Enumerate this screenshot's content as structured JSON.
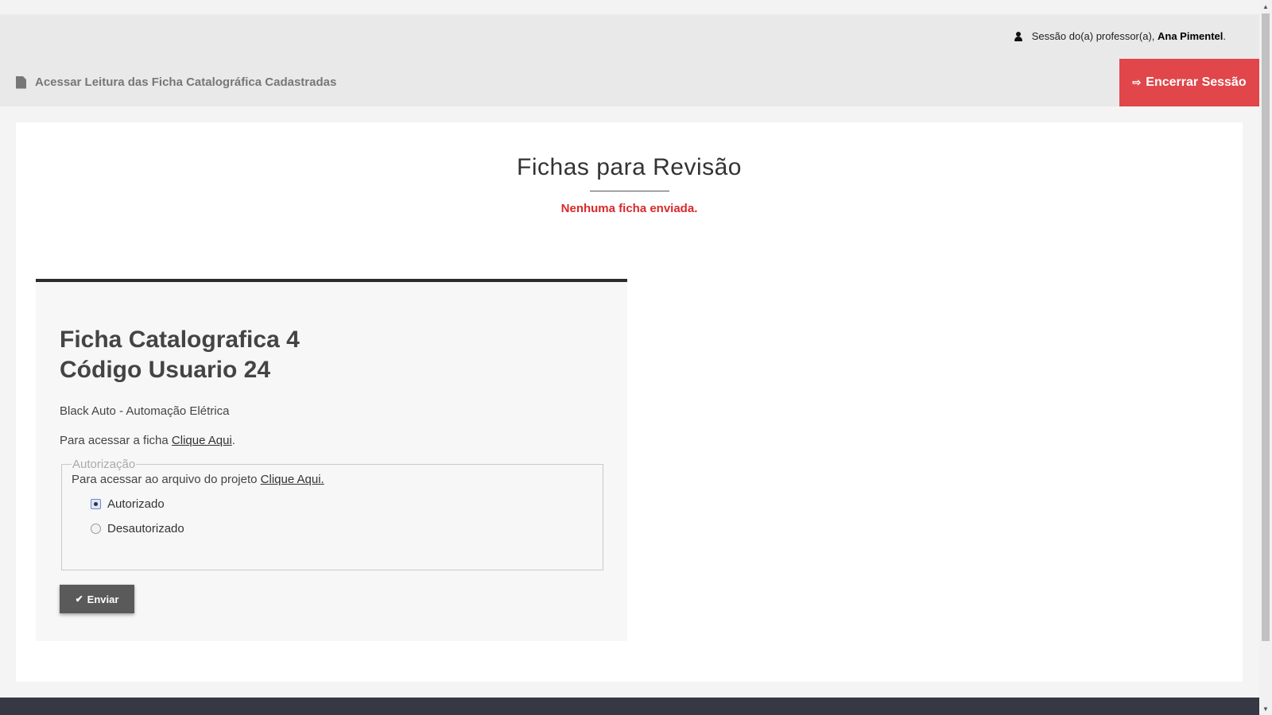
{
  "header": {
    "session_prefix": "Sessão do(a) professor(a),",
    "session_user": "Ana Pimentel",
    "session_suffix": ".",
    "page_link": "Acessar Leitura das Ficha Catalográfica Cadastradas",
    "logout_label": "Encerrar Sessão",
    "logout_color": "#e0464a"
  },
  "main": {
    "title": "Fichas para Revisão",
    "status": "Nenhuma ficha enviada.",
    "status_color": "#d9292b"
  },
  "ficha": {
    "title_line1": "Ficha Catalografica 4",
    "title_line2": "Código Usuario 24",
    "description": "Black Auto - Automação Elétrica",
    "access_prefix": "Para acessar a ficha ",
    "access_link": "Clique Aqui",
    "access_suffix": ".",
    "auth": {
      "legend": "Autorização",
      "access_prefix": "Para acessar ao arquivo do projeto ",
      "access_link": "Clique Aqui.",
      "options": [
        "Autorizado",
        "Desautorizado"
      ],
      "selected": "Autorizado"
    },
    "send_label": "Enviar"
  },
  "icons": {
    "user": "user-icon",
    "document": "document-icon",
    "logout": "sign-out-icon",
    "check": "check-icon"
  }
}
